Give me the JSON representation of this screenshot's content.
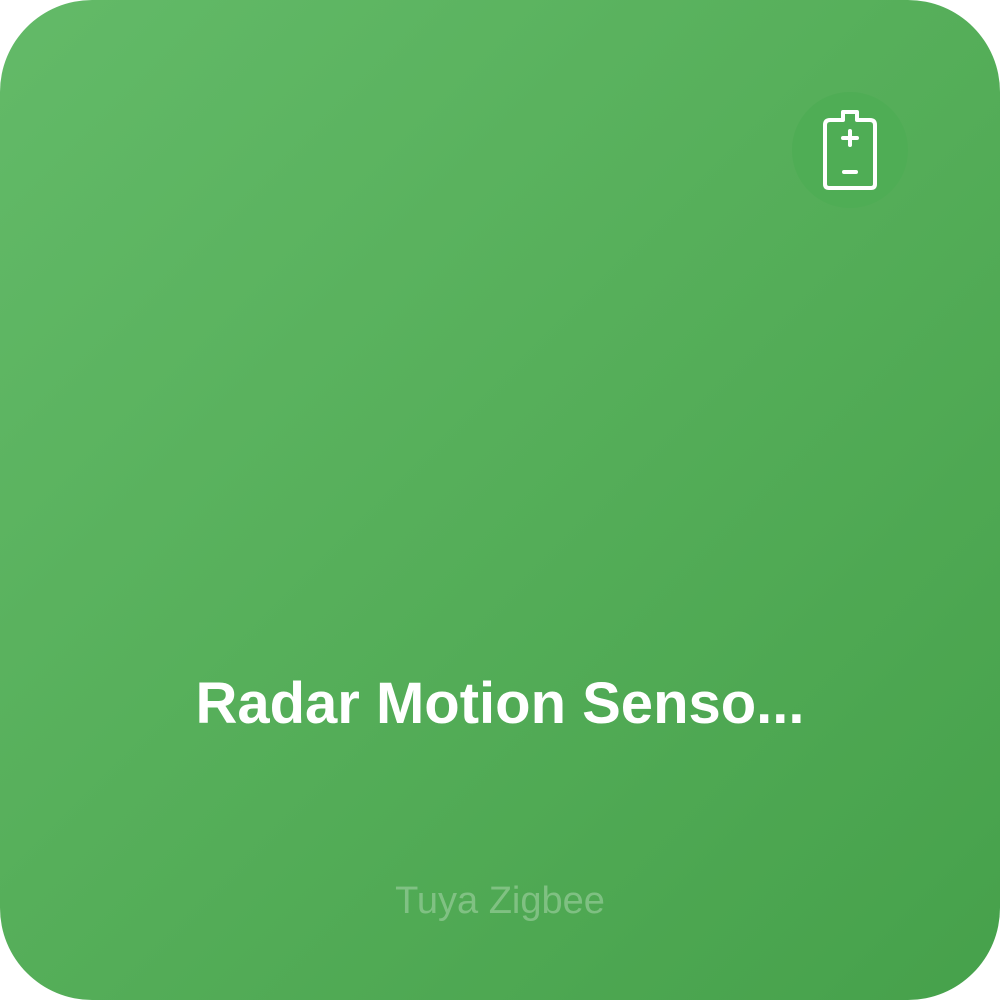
{
  "device": {
    "name": "Radar Motion Senso...",
    "manufacturer": "Tuya Zigbee",
    "status_icon": "battery-icon",
    "colors": {
      "card_gradient_start": "#63ba68",
      "card_gradient_end": "#46a14b",
      "badge": "#4fad55",
      "text": "#ffffff"
    }
  }
}
